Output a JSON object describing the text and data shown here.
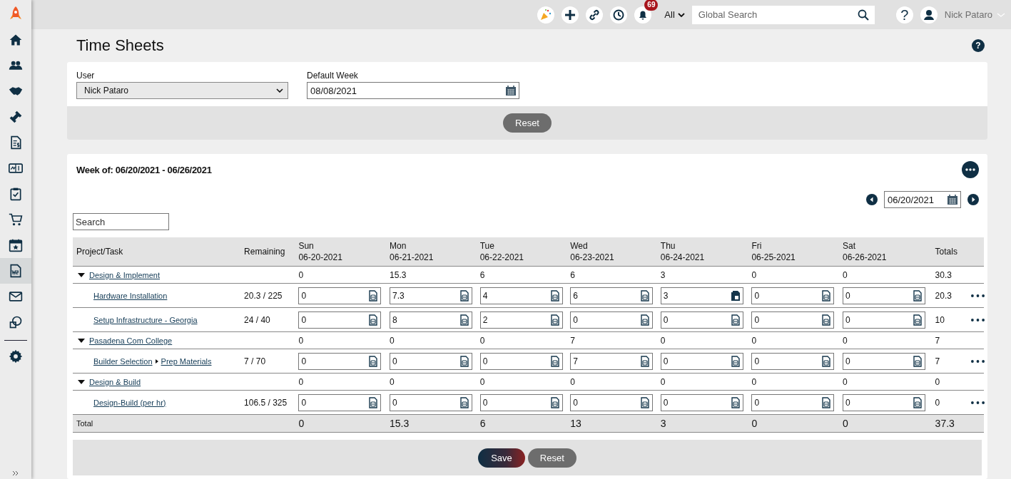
{
  "sidebar": {
    "items": [
      {
        "selected": false
      },
      {
        "selected": false
      },
      {
        "selected": false
      },
      {
        "selected": false
      },
      {
        "selected": false
      },
      {
        "selected": false
      },
      {
        "selected": false
      },
      {
        "selected": false
      },
      {
        "selected": false
      },
      {
        "selected": true
      },
      {
        "selected": false
      },
      {
        "selected": false
      },
      {
        "selected": false
      }
    ]
  },
  "topbar": {
    "notifications": "69",
    "scope": "All",
    "search_placeholder": "Global Search",
    "help": "?",
    "user": "Nick Pataro"
  },
  "page": {
    "title": "Time Sheets"
  },
  "filters": {
    "user_label": "User",
    "user_value": "Nick Pataro",
    "week_label": "Default Week",
    "week_value": "08/08/2021",
    "reset": "Reset"
  },
  "week": {
    "title": "Week of: 06/20/2021 - 06/26/2021",
    "date": "06/20/2021",
    "search_placeholder": "Search"
  },
  "table": {
    "columns": [
      {
        "label": "Project/Task"
      },
      {
        "label": "Remaining"
      },
      {
        "label": "Sun",
        "date": "06-20-2021"
      },
      {
        "label": "Mon",
        "date": "06-21-2021"
      },
      {
        "label": "Tue",
        "date": "06-22-2021"
      },
      {
        "label": "Wed",
        "date": "06-23-2021"
      },
      {
        "label": "Thu",
        "date": "06-24-2021"
      },
      {
        "label": "Fri",
        "date": "06-25-2021"
      },
      {
        "label": "Sat",
        "date": "06-26-2021"
      },
      {
        "label": "Totals"
      }
    ],
    "groups": [
      {
        "name": "Design & Implement",
        "expanded": true,
        "days": [
          "0",
          "15.3",
          "6",
          "6",
          "3",
          "0",
          "0"
        ],
        "total": "30.3",
        "tasks": [
          {
            "links": [
              "Hardware Installation"
            ],
            "remaining": "20.3 / 225",
            "hours": [
              {
                "value": "0",
                "note": false
              },
              {
                "value": "7.3",
                "note": false
              },
              {
                "value": "4",
                "note": false
              },
              {
                "value": "6",
                "note": false
              },
              {
                "value": "3",
                "note": true
              },
              {
                "value": "0",
                "note": false
              },
              {
                "value": "0",
                "note": false
              }
            ],
            "total": "20.3"
          },
          {
            "links": [
              "Setup Infrastructure - Georgia"
            ],
            "remaining": "24 / 40",
            "hours": [
              {
                "value": "0",
                "note": false
              },
              {
                "value": "8",
                "note": false
              },
              {
                "value": "2",
                "note": false
              },
              {
                "value": "0",
                "note": false
              },
              {
                "value": "0",
                "note": false
              },
              {
                "value": "0",
                "note": false
              },
              {
                "value": "0",
                "note": false
              }
            ],
            "total": "10"
          }
        ]
      },
      {
        "name": "Pasadena Com College",
        "expanded": true,
        "days": [
          "0",
          "0",
          "0",
          "7",
          "0",
          "0",
          "0"
        ],
        "total": "7",
        "tasks": [
          {
            "links": [
              "Builder Selection",
              "Prep Materials"
            ],
            "remaining": "7 / 70",
            "hours": [
              {
                "value": "0",
                "note": false
              },
              {
                "value": "0",
                "note": false
              },
              {
                "value": "0",
                "note": false
              },
              {
                "value": "7",
                "note": false
              },
              {
                "value": "0",
                "note": false
              },
              {
                "value": "0",
                "note": false
              },
              {
                "value": "0",
                "note": false
              }
            ],
            "total": "7"
          }
        ]
      },
      {
        "name": "Design & Build",
        "expanded": true,
        "days": [
          "0",
          "0",
          "0",
          "0",
          "0",
          "0",
          "0"
        ],
        "total": "0",
        "tasks": [
          {
            "links": [
              "Design-Build (per hr)"
            ],
            "remaining": "106.5 / 325",
            "hours": [
              {
                "value": "0",
                "note": false
              },
              {
                "value": "0",
                "note": false
              },
              {
                "value": "0",
                "note": false
              },
              {
                "value": "0",
                "note": false
              },
              {
                "value": "0",
                "note": false
              },
              {
                "value": "0",
                "note": false
              },
              {
                "value": "0",
                "note": false
              }
            ],
            "total": "0"
          }
        ]
      }
    ],
    "total_row": {
      "label": "Total",
      "days": [
        "0",
        "15.3",
        "6",
        "13",
        "3",
        "0",
        "0"
      ],
      "total": "37.3"
    }
  },
  "footer": {
    "save": "Save",
    "reset": "Reset"
  }
}
